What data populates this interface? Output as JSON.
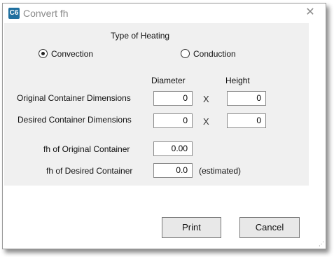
{
  "window": {
    "title": "Convert fh",
    "app_icon_text": "C6",
    "close_glyph": "✕"
  },
  "heating": {
    "heading": "Type of Heating",
    "options": [
      {
        "label": "Convection",
        "selected": true
      },
      {
        "label": "Conduction",
        "selected": false
      }
    ]
  },
  "dimensions": {
    "col_diameter": "Diameter",
    "col_height": "Height",
    "separator": "X",
    "rows": [
      {
        "label": "Original Container Dimensions",
        "diameter": "0",
        "height": "0"
      },
      {
        "label": "Desired Container Dimensions",
        "diameter": "0",
        "height": "0"
      }
    ]
  },
  "fh": {
    "original_label": "fh of Original Container",
    "original_value": "0.00",
    "desired_label": "fh of Desired Container",
    "desired_value": "0.0",
    "estimated_note": "(estimated)"
  },
  "buttons": {
    "print": "Print",
    "cancel": "Cancel"
  },
  "icons": {
    "app": "app-icon",
    "close": "close-icon",
    "resize": "resize-grip-icon"
  },
  "colors": {
    "panel_bg": "#f0f0f0",
    "app_icon_bg": "#1f6f9f"
  }
}
